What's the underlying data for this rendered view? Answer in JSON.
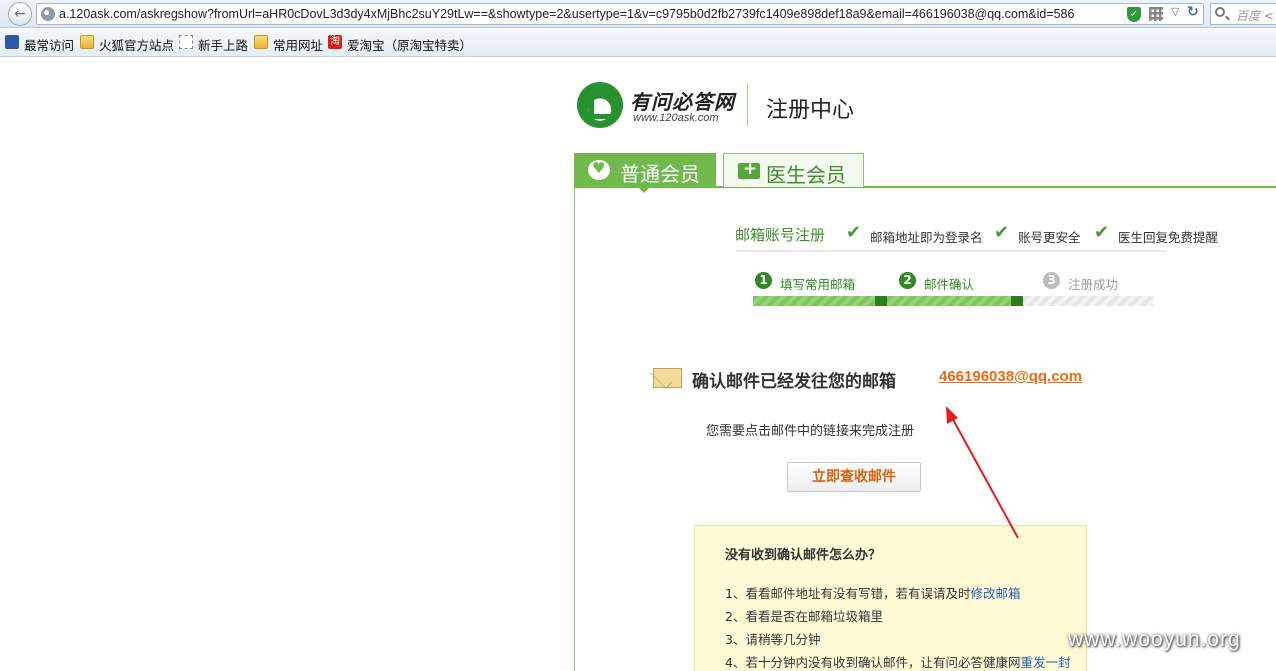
{
  "browser": {
    "url": "a.120ask.com/askregshow?fromUrl=aHR0cDovL3d3dy4xMjBhc2suY29tLw==&showtype=2&usertype=1&v=c9795b0d2fb2739fc1409e898def18a9&email=466196038@qq.com&id=586",
    "search_placeholder": "百度 <"
  },
  "bookmarks": [
    {
      "label": "最常访问",
      "icon": "most-visited-icon"
    },
    {
      "label": "火狐官方站点",
      "icon": "folder-icon"
    },
    {
      "label": "新手上路",
      "icon": "page-icon"
    },
    {
      "label": "常用网址",
      "icon": "folder-icon"
    },
    {
      "label": "爱淘宝（原淘宝特卖）",
      "icon": "taobao-icon",
      "icon_text": "淘"
    }
  ],
  "brand": {
    "name": "有问必答网",
    "url": "www.120ask.com",
    "section_title": "注册中心",
    "accent": "#6fb94d"
  },
  "tabs": [
    {
      "label": "普通会员",
      "active": true
    },
    {
      "label": "医生会员",
      "active": false
    }
  ],
  "registration": {
    "title": "邮箱账号注册",
    "features": [
      "邮箱地址即为登录名",
      "账号更安全",
      "医生回复免费提醒"
    ],
    "steps": [
      {
        "num": "1",
        "label": "填写常用邮箱",
        "done": true
      },
      {
        "num": "2",
        "label": "邮件确认",
        "done": true
      },
      {
        "num": "3",
        "label": "注册成功",
        "done": false
      }
    ],
    "progress": 0.675
  },
  "confirm": {
    "message": "确认邮件已经发往您的邮箱",
    "email": "466196038@qq.com",
    "instruction": "您需要点击邮件中的链接来完成注册",
    "button": "立即查收邮件"
  },
  "help": {
    "title": "没有收到确认邮件怎么办？",
    "items": [
      {
        "text": "1、看看邮件地址有没有写错，若有误请及时",
        "link": "修改邮箱"
      },
      {
        "text": "2、看看是否在邮箱垃圾箱里",
        "link": ""
      },
      {
        "text": "3、请稍等几分钟",
        "link": ""
      },
      {
        "text": "4、若十分钟内没有收到确认邮件，让有问必答健康网",
        "link": "重发一封"
      }
    ]
  },
  "watermark": "www.wooyun.org"
}
